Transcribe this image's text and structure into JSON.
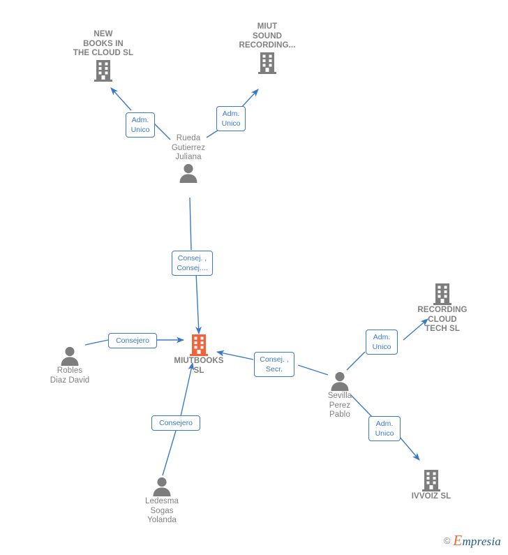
{
  "diagram": {
    "title": "MIUTBOOKS SL corporate relationship graph",
    "accent_color": "#3a79c9",
    "focus_color": "#f4623a",
    "node_color": "#7a7a7a",
    "label_text_color": "#3a79c9",
    "background": "#ffffff"
  },
  "nodes": {
    "new_books": {
      "label": "NEW\nBOOKS IN\nTHE CLOUD  SL",
      "type": "company",
      "icon": "building-icon"
    },
    "miut_sound": {
      "label": "MIUT\nSOUND\nRECORDING...",
      "type": "company",
      "icon": "building-icon"
    },
    "rueda": {
      "label": "Rueda\nGutierrez\nJuliana",
      "type": "person",
      "icon": "person-icon"
    },
    "miutbooks": {
      "label": "MIUTBOOKS\nSL",
      "type": "company",
      "icon": "building-icon-highlighted"
    },
    "robles": {
      "label": "Robles\nDiaz David",
      "type": "person",
      "icon": "person-icon"
    },
    "ledesma": {
      "label": "Ledesma\nSogas\nYolanda",
      "type": "person",
      "icon": "person-icon"
    },
    "sevilla": {
      "label": "Sevilla\nPerez\nPablo",
      "type": "person",
      "icon": "person-icon"
    },
    "recording_cloud": {
      "label": "RECORDING\nCLOUD\nTECH  SL",
      "type": "company",
      "icon": "building-icon"
    },
    "ivvoiz": {
      "label": "IVVOIZ  SL",
      "type": "company",
      "icon": "building-icon"
    }
  },
  "edge_labels": {
    "rueda_to_new_books": "Adm.\nUnico",
    "rueda_to_miut_sound": "Adm.\nUnico",
    "rueda_to_miutbooks": "Consej. ,\nConsej....",
    "robles_to_miutbooks": "Consejero",
    "ledesma_to_miutbooks": "Consejero",
    "sevilla_to_miutbooks": "Consej. ,\nSecr.",
    "sevilla_to_recording_cloud": "Adm.\nUnico",
    "sevilla_to_ivvoiz": "Adm.\nUnico"
  },
  "watermark": {
    "copyright": "©",
    "brand_initial": "E",
    "brand_rest": "mpresia"
  }
}
